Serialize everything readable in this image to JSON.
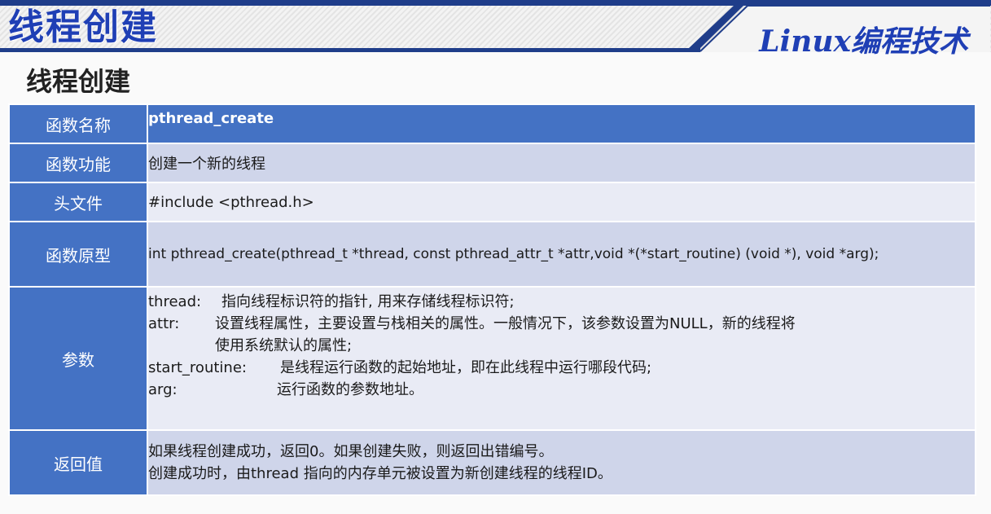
{
  "header": {
    "title": "线程创建",
    "course": "Linux编程技术"
  },
  "section_heading": "线程创建",
  "table": {
    "name": {
      "label": "函数名称",
      "value": "pthread_create"
    },
    "function": {
      "label": "函数功能",
      "value": "创建一个新的线程"
    },
    "header_file": {
      "label": "头文件",
      "value": "#include <pthread.h>"
    },
    "prototype": {
      "label": "函数原型",
      "value": "int pthread_create(pthread_t *thread, const pthread_attr_t *attr,void *(*start_routine) (void *), void *arg);"
    },
    "params": {
      "label": "参数",
      "thread_name": "thread:",
      "thread_desc": "指向线程标识符的指针, 用来存储线程标识符;",
      "attr_name": "attr:",
      "attr_desc_1": "设置线程属性，主要设置与栈相关的属性。一般情况下，该参数设置为NULL，新的线程将",
      "attr_desc_2": "使用系统默认的属性;",
      "start_name": "start_routine:",
      "start_desc": "是线程运行函数的起始地址，即在此线程中运行哪段代码;",
      "arg_name": "arg:",
      "arg_desc": "运行函数的参数地址。"
    },
    "return": {
      "label": "返回值",
      "line1": "如果线程创建成功，返回0。如果创建失败，则返回出错编号。",
      "line2": "创建成功时，由thread 指向的内存单元被设置为新创建线程的线程ID。"
    }
  },
  "colors": {
    "header_blue": "#1f3d8a",
    "title_blue": "#1f3fb5",
    "label_fill": "#4472c4",
    "row_dark": "#cfd5ea",
    "row_light": "#e9ebf5"
  }
}
